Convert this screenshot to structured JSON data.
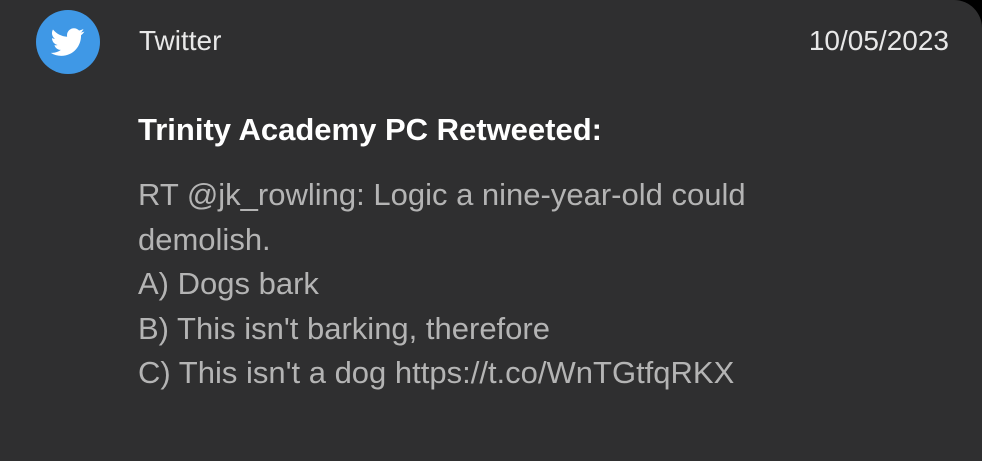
{
  "notification": {
    "app_name": "Twitter",
    "app_icon": "twitter-bird-icon",
    "accent_color": "#3f98e6",
    "timestamp": "10/05/2023",
    "title": "Trinity Academy PC Retweeted:",
    "body_lines": [
      "RT @jk_rowling: Logic a nine-year-old could",
      "demolish.",
      "A) Dogs bark",
      "B) This isn't barking, therefore",
      "C) This isn't a dog https://t.co/WnTGtfqRKX"
    ]
  }
}
